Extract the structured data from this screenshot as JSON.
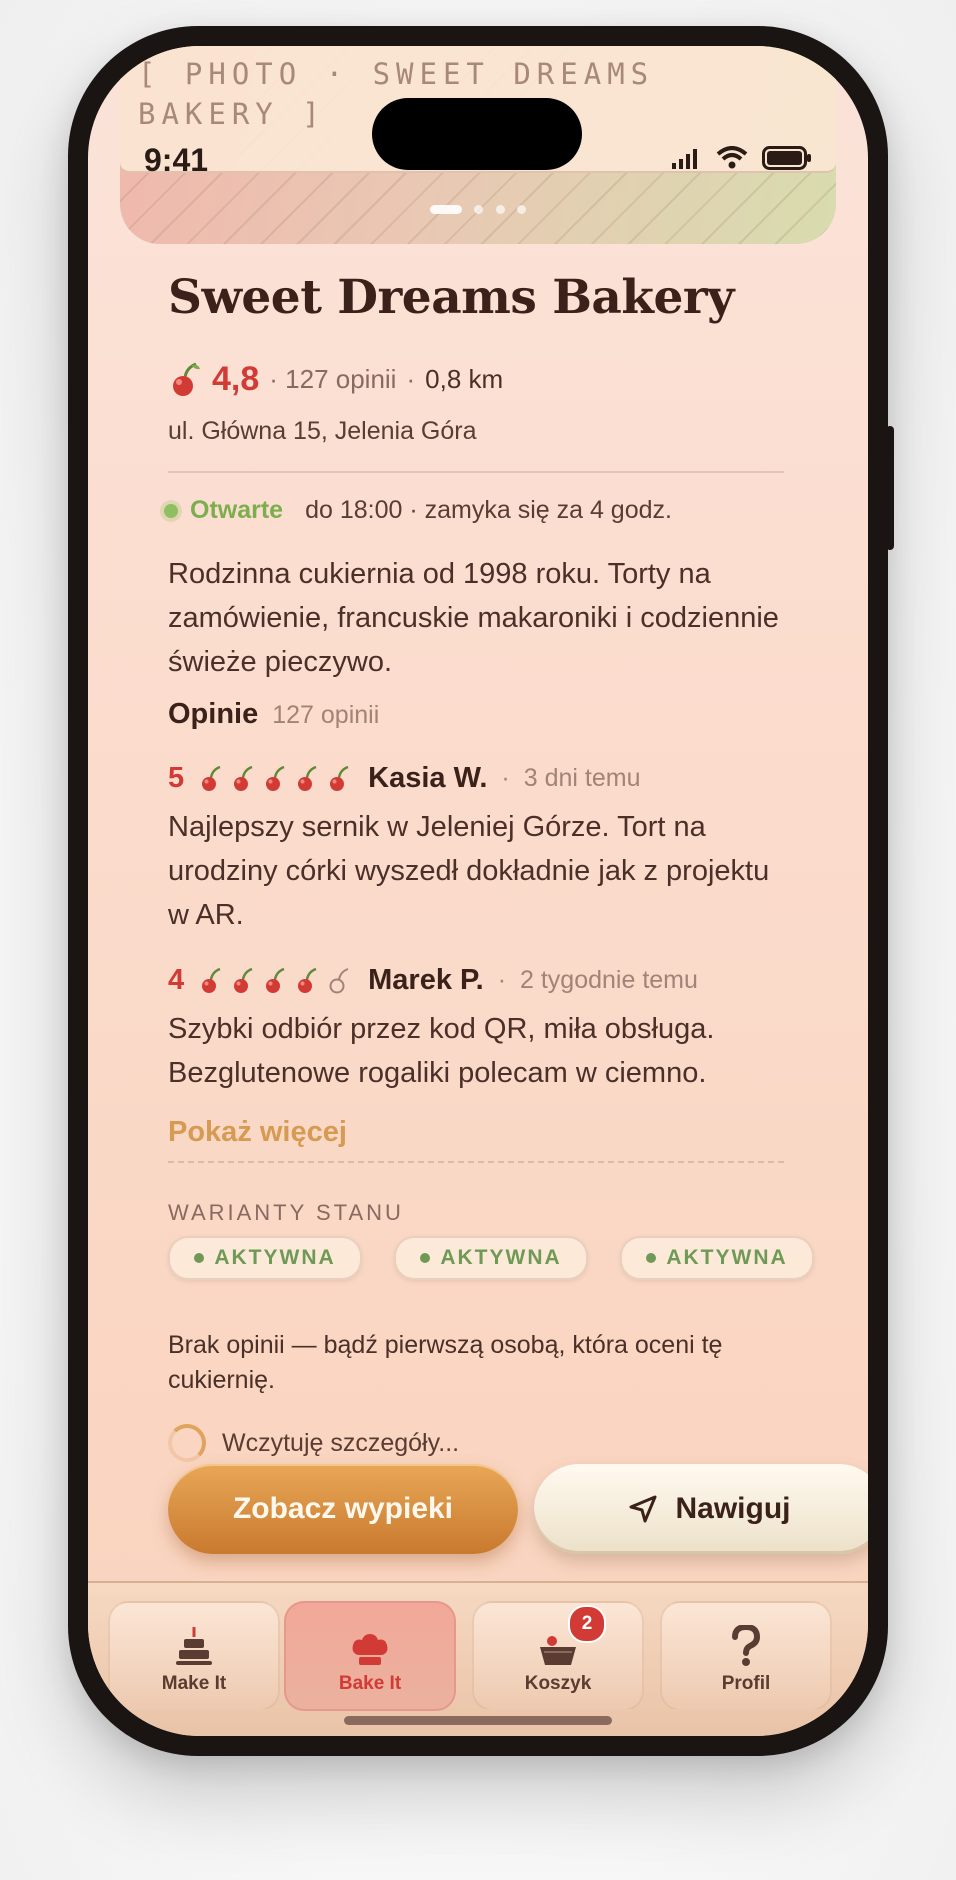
{
  "status_bar": {
    "time": "9:41"
  },
  "hero": {
    "label": "[ PHOTO · SWEET DREAMS BAKERY ]",
    "slides": 4,
    "active_slide": 1
  },
  "bakery": {
    "name": "Sweet Dreams Bakery",
    "rating": "4,8",
    "reviews_count": "· 127 opinii",
    "distance": "0,8 km",
    "address": "ul. Główna 15, Jelenia Góra",
    "open_status": "Otwarte",
    "hours": "do 18:00 · zamyka się za 4 godz.",
    "description": "Rodzinna cukiernia od 1998 roku. Torty na zamówienie, francuskie makaroniki i codziennie świeże pieczywo."
  },
  "reviews_section": {
    "title": "Opinie",
    "count": "127 opinii",
    "reviews": [
      {
        "score": "5",
        "cherries_filled": 5,
        "author": "Kasia W.",
        "time": "3 dni temu",
        "text": "Najlepszy sernik w Jeleniej Górze. Tort na urodziny córki wyszedł dokładnie jak z projektu w AR."
      },
      {
        "score": "4",
        "cherries_filled": 4,
        "author": "Marek P.",
        "time": "2 tygodnie temu",
        "text": "Szybki odbiór przez kod QR, miła obsługa. Bezglutenowe rogaliki polecam w ciemno."
      }
    ],
    "show_more": "Pokaż więcej"
  },
  "variants": {
    "label": "WARIANTY STANU",
    "chips": [
      "AKTYWNA",
      "AKTYWNA",
      "AKTYWNA"
    ],
    "empty_text": "Brak opinii — bądź pierwszą osobą, która oceni tę cukiernię.",
    "loading_text": "Wczytuję szczegóły..."
  },
  "actions": {
    "primary": "Zobacz wypieki",
    "secondary": "Nawiguj"
  },
  "tabbar": {
    "tabs": [
      {
        "label": "Make It",
        "icon": "cake-icon"
      },
      {
        "label": "Bake It",
        "icon": "chef-hat-icon",
        "active": true
      },
      {
        "label": "Koszyk",
        "icon": "basket-icon",
        "badge": "2"
      },
      {
        "label": "Profil",
        "icon": "question-icon"
      }
    ]
  },
  "colors": {
    "accent": "#d23b35",
    "open": "#7cae4d",
    "cta": "#d69a52",
    "variant": "#6e9a56"
  }
}
